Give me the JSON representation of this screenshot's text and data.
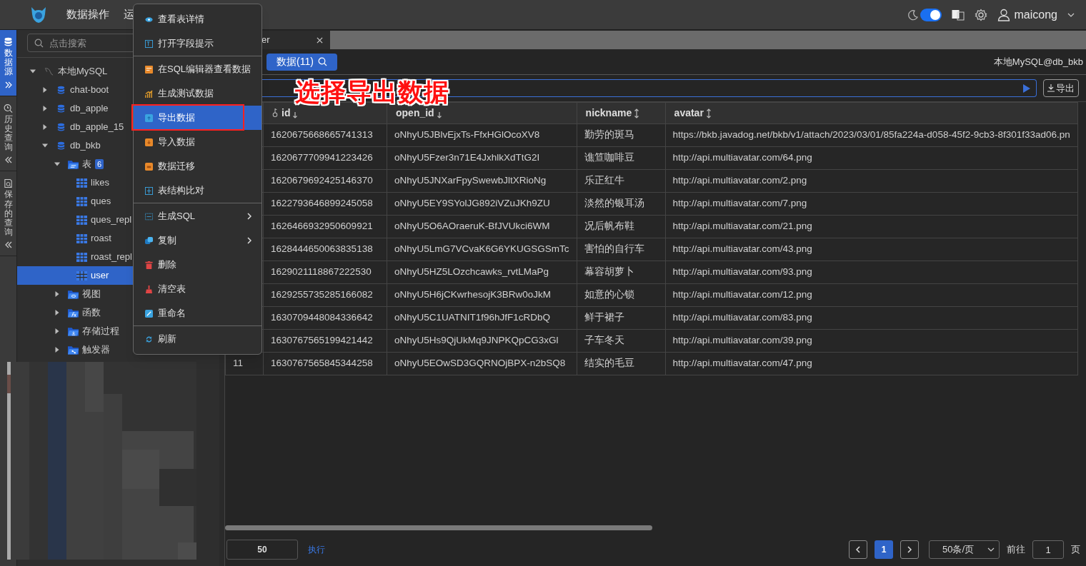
{
  "header": {
    "nav": [
      {
        "label": "数据操作"
      },
      {
        "label": "运"
      }
    ],
    "dark_mode": true,
    "user": "maicong"
  },
  "side_tabs": [
    {
      "label": "数据源",
      "selected": true
    },
    {
      "label": "历史查询",
      "selected": false
    },
    {
      "label": "保存的查询",
      "selected": false
    }
  ],
  "sidebar": {
    "search_placeholder": "点击搜索",
    "tree": [
      {
        "label": "本地MySQL",
        "kind": "connection",
        "expanded": true,
        "selected": false,
        "children": [
          {
            "label": "chat-boot",
            "kind": "database",
            "expanded": false,
            "selected": false
          },
          {
            "label": "db_apple",
            "kind": "database",
            "expanded": false,
            "selected": false
          },
          {
            "label": "db_apple_15",
            "kind": "database",
            "expanded": false,
            "selected": false
          },
          {
            "label": "db_bkb",
            "kind": "database",
            "expanded": true,
            "selected": false,
            "children": [
              {
                "label": "表",
                "kind": "tables",
                "badge": "6",
                "expanded": true,
                "selected": false,
                "children": [
                  {
                    "label": "likes",
                    "kind": "table",
                    "selected": false
                  },
                  {
                    "label": "ques",
                    "kind": "table",
                    "selected": false
                  },
                  {
                    "label": "ques_repl",
                    "kind": "table",
                    "selected": false
                  },
                  {
                    "label": "roast",
                    "kind": "table",
                    "selected": false
                  },
                  {
                    "label": "roast_repl",
                    "kind": "table",
                    "selected": false
                  },
                  {
                    "label": "user",
                    "kind": "table",
                    "selected": true
                  }
                ]
              },
              {
                "label": "视图",
                "kind": "views",
                "expanded": false,
                "selected": false
              },
              {
                "label": "函数",
                "kind": "functions",
                "expanded": false,
                "selected": false
              },
              {
                "label": "存储过程",
                "kind": "procedures",
                "expanded": false,
                "selected": false
              },
              {
                "label": "触发器",
                "kind": "triggers",
                "expanded": false,
                "selected": false
              }
            ]
          }
        ]
      }
    ]
  },
  "tabs": [
    {
      "label": "er",
      "selected": true
    }
  ],
  "toolbar": {
    "data_button": "数据(11)",
    "connection": "本地MySQL@db_bkb"
  },
  "filter": {
    "export_button": "导出"
  },
  "annotation": "选择导出数据",
  "table": {
    "columns": [
      {
        "label": "id",
        "key": true,
        "sorted": true
      },
      {
        "label": "open_id",
        "key": false,
        "sorted": true
      },
      {
        "label": "nickname",
        "key": false,
        "sorted": false
      },
      {
        "label": "avatar",
        "key": false,
        "sorted": false
      }
    ],
    "rows": [
      {
        "cells": [
          "1620675668665741313",
          "oNhyU5JBlvEjxTs-FfxHGlOcoXV8",
          "勤劳的斑马",
          "https://bkb.javadog.net/bkb/v1/attach/2023/03/01/85fa224a-d058-45f2-9cb3-8f301f33ad06.pn"
        ]
      },
      {
        "cells": [
          "1620677709941223426",
          "oNhyU5Fzer3n71E4JxhlkXdTtG2I",
          "谯笪咖啡豆",
          "http://api.multiavatar.com/64.png"
        ]
      },
      {
        "cells": [
          "1620679692425146370",
          "oNhyU5JNXarFpySwewbJltXRioNg",
          "乐正红牛",
          "http://api.multiavatar.com/2.png"
        ]
      },
      {
        "cells": [
          "1622793646899245058",
          "oNhyU5EY9SYolJG892iVZuJKh9ZU",
          "淡然的银耳汤",
          "http://api.multiavatar.com/7.png"
        ]
      },
      {
        "cells": [
          "1626466932950609921",
          "oNhyU5O6AOraeruK-BfJVUkci6WM",
          "况后帆布鞋",
          "http://api.multiavatar.com/21.png"
        ]
      },
      {
        "cells": [
          "1628444650063835138",
          "oNhyU5LmG7VCvaK6G6YKUGSGSmTc",
          "害怕的自行车",
          "http://api.multiavatar.com/43.png"
        ]
      },
      {
        "cells": [
          "1629021118867222530",
          "oNhyU5HZ5LOzchcawks_rvtLMaPg",
          "幕容胡萝卜",
          "http://api.multiavatar.com/93.png"
        ]
      },
      {
        "cells": [
          "1629255735285166082",
          "oNhyU5H6jCKwrhesojK3BRw0oJkM",
          "如意的心锁",
          "http://api.multiavatar.com/12.png"
        ]
      },
      {
        "cells": [
          "1630709448084336642",
          "oNhyU5C1UATNIT1f96hJfF1cRDbQ",
          "鲜于裙子",
          "http://api.multiavatar.com/83.png"
        ]
      },
      {
        "cells": [
          "1630767565199421442",
          "oNhyU5Hs9QjUkMq9JNPKQpCG3xGl",
          "子车冬天",
          "http://api.multiavatar.com/39.png"
        ]
      },
      {
        "number": "11",
        "cells": [
          "1630767565845344258",
          "oNhyU5EOwSD3GQRNOjBPX-n2bSQ8",
          "结实的毛豆",
          "http://api.multiavatar.com/47.png"
        ]
      }
    ]
  },
  "footer": {
    "limit": "50",
    "run": "执行",
    "pages": [
      {
        "label": "1",
        "selected": true
      }
    ],
    "page_size": "50条/页",
    "goto_label": "前往",
    "goto_value": "1",
    "page_unit": "页"
  },
  "context_menu": {
    "groups": [
      [
        {
          "label": "查看表详情",
          "kind": "eye",
          "submenu": false,
          "selected": false,
          "outlined": false
        },
        {
          "label": "打开字段提示",
          "kind": "hint",
          "submenu": false,
          "selected": false,
          "outlined": false
        }
      ],
      [
        {
          "label": "在SQL编辑器查看数据",
          "kind": "editor",
          "submenu": false,
          "selected": false,
          "outlined": false
        },
        {
          "label": "生成测试数据",
          "kind": "chart",
          "submenu": false,
          "selected": false,
          "outlined": false
        },
        {
          "label": "导出数据",
          "kind": "export",
          "submenu": false,
          "selected": true,
          "outlined": true
        },
        {
          "label": "导入数据",
          "kind": "import",
          "submenu": false,
          "selected": false,
          "outlined": false
        },
        {
          "label": "数据迁移",
          "kind": "migrate",
          "submenu": false,
          "selected": false,
          "outlined": false
        },
        {
          "label": "表结构比对",
          "kind": "compare",
          "submenu": false,
          "selected": false,
          "outlined": false
        }
      ],
      [
        {
          "label": "生成SQL",
          "kind": "sql",
          "submenu": true,
          "selected": false,
          "outlined": false
        },
        {
          "label": "复制",
          "kind": "copy",
          "submenu": true,
          "selected": false,
          "outlined": false
        },
        {
          "label": "删除",
          "kind": "delete",
          "submenu": false,
          "selected": false,
          "outlined": false
        },
        {
          "label": "清空表",
          "kind": "clear",
          "submenu": false,
          "selected": false,
          "outlined": false
        },
        {
          "label": "重命名",
          "kind": "rename",
          "submenu": false,
          "selected": false,
          "outlined": false
        }
      ],
      [
        {
          "label": "刷新",
          "kind": "refresh",
          "submenu": false,
          "selected": false,
          "outlined": false
        }
      ]
    ]
  }
}
